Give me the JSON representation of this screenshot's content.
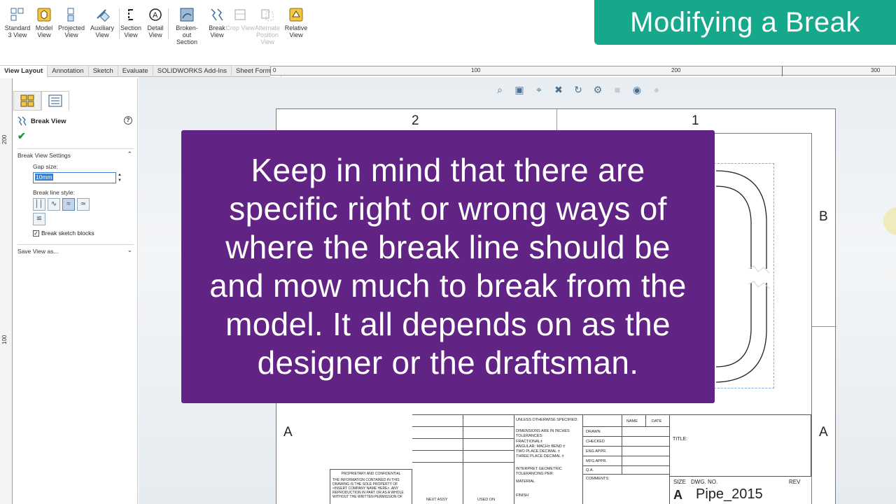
{
  "badge": {
    "title": "Modifying a Break"
  },
  "ribbon": {
    "buttons": [
      {
        "label": "Standard 3 View",
        "icon": "standard-3-view-icon",
        "enabled": true
      },
      {
        "label": "Model View",
        "icon": "model-view-icon",
        "enabled": true
      },
      {
        "label": "Projected View",
        "icon": "projected-view-icon",
        "enabled": true
      },
      {
        "label": "Auxiliary View",
        "icon": "auxiliary-view-icon",
        "enabled": true
      },
      {
        "label": "Section View",
        "icon": "section-view-icon",
        "enabled": true
      },
      {
        "label": "Detail View",
        "icon": "detail-view-icon",
        "enabled": true
      },
      {
        "label": "Broken-out Section",
        "icon": "broken-out-section-icon",
        "enabled": true
      },
      {
        "label": "Break View",
        "icon": "break-view-icon",
        "enabled": true
      },
      {
        "label": "Crop View",
        "icon": "crop-view-icon",
        "enabled": false
      },
      {
        "label": "Alternate Position View",
        "icon": "alternate-position-view-icon",
        "enabled": false
      },
      {
        "label": "Relative View",
        "icon": "relative-view-icon",
        "enabled": true
      }
    ]
  },
  "tabs": [
    "View Layout",
    "Annotation",
    "Sketch",
    "Evaluate",
    "SOLIDWORKS Add-Ins",
    "Sheet Format"
  ],
  "ruler": {
    "h_labels": [
      "0",
      "100",
      "200",
      "300"
    ],
    "v_labels": [
      "200",
      "100"
    ]
  },
  "property_manager": {
    "title": "Break View",
    "help": "?",
    "ok": "✔",
    "settings_title": "Break View Settings",
    "gap_label": "Gap size:",
    "gap_value": "10mm",
    "style_label": "Break line style:",
    "checkbox_label": "Break sketch blocks",
    "checkbox_checked": true,
    "save_view_title": "Save View as..."
  },
  "sheet": {
    "col_labels": [
      "2",
      "1"
    ],
    "row_labels_right": [
      "B",
      "A"
    ],
    "row_labels_left": [
      "A"
    ]
  },
  "title_block": {
    "unless": "UNLESS OTHERWISE SPECIFIED:",
    "name": "NAME",
    "date": "DATE",
    "dims": "DIMENSIONS ARE IN INCHES",
    "tolerances": "TOLERANCES:",
    "fractional": "FRACTIONAL±",
    "angular": "ANGULAR: MACH±   BEND ±",
    "two_place": "TWO PLACE DECIMAL   ±",
    "three_place": "THREE PLACE DECIMAL  ±",
    "interpret": "INTERPRET GEOMETRIC",
    "tolerancing": "TOLERANCING PER:",
    "material": "MATERIAL",
    "finish": "FINISH",
    "next_assy": "NEXT ASSY",
    "used_on": "USED ON",
    "drawn": "DRAWN",
    "checked": "CHECKED",
    "eng_appr": "ENG APPR.",
    "mfg_appr": "MFG APPR.",
    "qa": "Q.A.",
    "comments": "COMMENTS:",
    "title": "TITLE:",
    "size_label": "SIZE",
    "size_value": "A",
    "dwg_no_label": "DWG.  NO.",
    "dwg_no_value": "Pipe_2015",
    "rev_label": "REV",
    "proprietary_title": "PROPRIETARY AND CONFIDENTIAL",
    "proprietary_text": "THE INFORMATION CONTAINED IN THIS DRAWING IS THE SOLE PROPERTY OF <INSERT COMPANY NAME HERE>. ANY REPRODUCTION IN PART OR AS A WHOLE WITHOUT THE WRITTEN PERMISSION OF"
  },
  "caption": {
    "text": "Keep in mind that there are specific right or wrong ways of where the break line should be and mow much to break from the model. It all depends on as the designer or the draftsman."
  },
  "colors": {
    "badge": "#16a88b",
    "caption": "#612384",
    "accent": "#3b7fd0"
  }
}
